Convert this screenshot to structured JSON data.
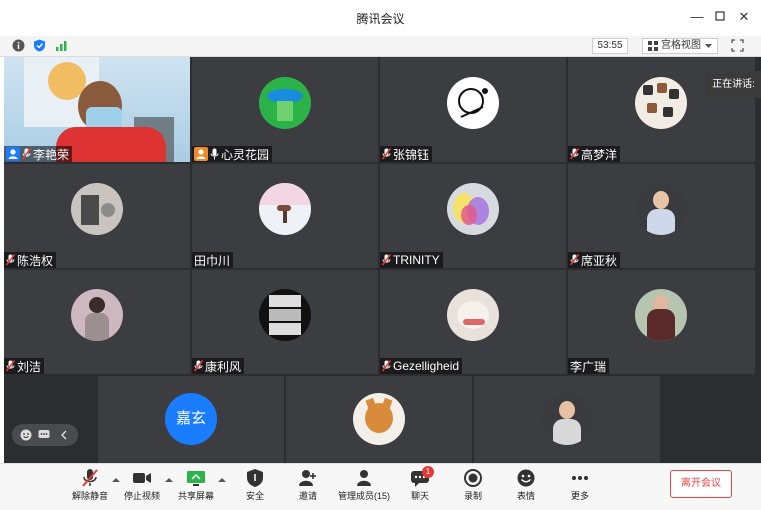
{
  "window": {
    "title": "腾讯会议"
  },
  "toolbar": {
    "timer": "53:55",
    "view_label": "宫格视图"
  },
  "speaking_label": "正在讲话:",
  "participants": [
    {
      "name": "李艳荣",
      "mic": "muted"
    },
    {
      "name": "心灵花园",
      "mic": "on"
    },
    {
      "name": "张锦钰",
      "mic": "muted"
    },
    {
      "name": "高梦洋",
      "mic": "muted"
    },
    {
      "name": "陈浩权",
      "mic": "muted"
    },
    {
      "name": "田巾川",
      "mic": "none"
    },
    {
      "name": "TRINITY",
      "mic": "muted"
    },
    {
      "name": "席亚秋",
      "mic": "muted"
    },
    {
      "name": "刘洁",
      "mic": "muted"
    },
    {
      "name": "康利风",
      "mic": "muted"
    },
    {
      "name": "Gezelligheid",
      "mic": "muted"
    },
    {
      "name": "李广瑞",
      "mic": "none"
    },
    {
      "name": "",
      "mic": "none",
      "avatar_text": "嘉玄"
    },
    {
      "name": "",
      "mic": "none"
    },
    {
      "name": "",
      "mic": "none"
    }
  ],
  "bottom_bar": {
    "unmute": "解除静音",
    "stop_video": "停止视频",
    "share_screen": "共享屏幕",
    "security": "安全",
    "invite": "邀请",
    "manage_members": "管理成员(15)",
    "chat": "聊天",
    "chat_badge": "1",
    "record": "录制",
    "reactions": "表情",
    "more": "更多",
    "leave": "离开会议"
  },
  "colors": {
    "accent_blue": "#1a7cff",
    "leave_red": "#e44444",
    "tile_bg": "#3c3d41",
    "grid_bg": "#2c2d30"
  }
}
